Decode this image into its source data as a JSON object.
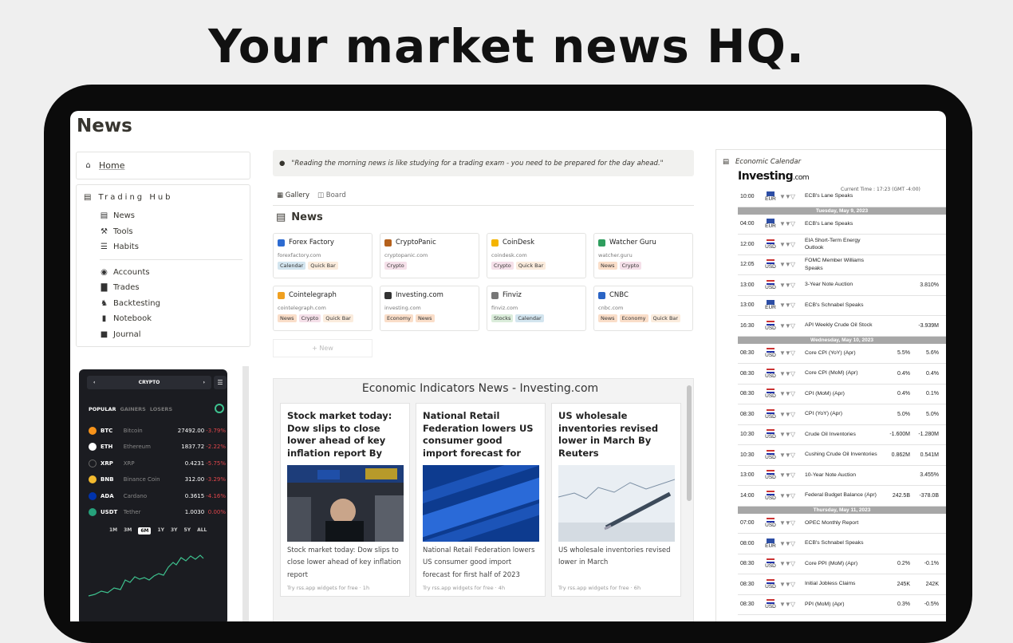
{
  "hero": {
    "title": "Your market news HQ."
  },
  "page": {
    "title": "News"
  },
  "sidebar": {
    "home": "Home",
    "hub_title": "Trading Hub",
    "group1": [
      {
        "label": "News",
        "icon": "newspaper-icon"
      },
      {
        "label": "Tools",
        "icon": "wrench-icon"
      },
      {
        "label": "Habits",
        "icon": "checklist-icon"
      }
    ],
    "group2": [
      {
        "label": "Accounts",
        "icon": "user-circle-icon"
      },
      {
        "label": "Trades",
        "icon": "bar-chart-icon"
      },
      {
        "label": "Backtesting",
        "icon": "chess-icon"
      },
      {
        "label": "Notebook",
        "icon": "book-icon"
      },
      {
        "label": "Journal",
        "icon": "journal-icon"
      }
    ]
  },
  "crypto_widget": {
    "header": "CRYPTO",
    "tabs": [
      "POPULAR",
      "GAINERS",
      "LOSERS"
    ],
    "rows": [
      {
        "symbol": "BTC",
        "name": "Bitcoin",
        "price": "27492.00",
        "change": "-3.79%",
        "color": "#f7931a"
      },
      {
        "symbol": "ETH",
        "name": "Ethereum",
        "price": "1837.72",
        "change": "-2.22%",
        "color": "#ffffff"
      },
      {
        "symbol": "XRP",
        "name": "XRP",
        "price": "0.4231",
        "change": "-5.75%",
        "color": "#1b1c21"
      },
      {
        "symbol": "BNB",
        "name": "Binance Coin",
        "price": "312.00",
        "change": "-3.29%",
        "color": "#f3ba2f"
      },
      {
        "symbol": "ADA",
        "name": "Cardano",
        "price": "0.3615",
        "change": "-4.16%",
        "color": "#0033ad"
      },
      {
        "symbol": "USDT",
        "name": "Tether",
        "price": "1.0030",
        "change": "0.00%",
        "color": "#26a17b"
      }
    ],
    "ranges": [
      "1M",
      "3M",
      "6M",
      "1Y",
      "3Y",
      "5Y",
      "ALL"
    ],
    "active_range": "6M"
  },
  "quote": "\"Reading the morning news is like studying for a trading exam - you need to be prepared for the day ahead.\"",
  "views": {
    "gallery": "Gallery",
    "board": "Board"
  },
  "news_heading": "News",
  "sources": [
    {
      "name": "Forex Factory",
      "url": "forexfactory.com",
      "tags": [
        "Calendar",
        "Quick Bar"
      ],
      "color": "#2d6bd1"
    },
    {
      "name": "CryptoPanic",
      "url": "cryptopanic.com",
      "tags": [
        "Crypto"
      ],
      "color": "#b5611c"
    },
    {
      "name": "CoinDesk",
      "url": "coindesk.com",
      "tags": [
        "Crypto",
        "Quick Bar"
      ],
      "color": "#f4b400"
    },
    {
      "name": "Watcher Guru",
      "url": "watcher.guru",
      "tags": [
        "News",
        "Crypto"
      ],
      "color": "#2f9e5e"
    },
    {
      "name": "Cointelegraph",
      "url": "cointelegraph.com",
      "tags": [
        "News",
        "Crypto",
        "Quick Bar"
      ],
      "color": "#f0a020"
    },
    {
      "name": "Investing.com",
      "url": "investing.com",
      "tags": [
        "Economy",
        "News"
      ],
      "color": "#333333"
    },
    {
      "name": "Finviz",
      "url": "finviz.com",
      "tags": [
        "Stocks",
        "Calendar"
      ],
      "color": "#777777"
    },
    {
      "name": "CNBC",
      "url": "cnbc.com",
      "tags": [
        "News",
        "Economy",
        "Quick Bar"
      ],
      "color": "#2a64c5"
    }
  ],
  "tag_colors": {
    "Calendar": "#d3e5ef",
    "Quick Bar": "#fbecdd",
    "Crypto": "#f5e0e9",
    "News": "#fadec9",
    "Economy": "#fadec9",
    "Stocks": "#dbeddb"
  },
  "new_label": "+ New",
  "rss": {
    "title": "Economic Indicators News - Investing.com",
    "items": [
      {
        "headline": "Stock market today: Dow slips to close lower ahead of key inflation report By Investing.com",
        "desc": "Stock market today: Dow slips to close lower ahead of key inflation report",
        "footer": "Try rss.app widgets for free  ·  1h"
      },
      {
        "headline": "National Retail Federation lowers US consumer good import forecast for first half of...",
        "desc": "National Retail Federation lowers US consumer good import forecast for first half of 2023",
        "footer": "Try rss.app widgets for free  ·  4h"
      },
      {
        "headline": "US wholesale inventories revised lower in March By Reuters",
        "desc": "US wholesale inventories revised lower in March",
        "footer": "Try rss.app widgets for free  ·  6h"
      }
    ]
  },
  "calendar": {
    "title": "Economic Calendar",
    "logo": "Investing",
    "logo_suffix": ".com",
    "current_time": "Current Time : 17:23 (GMT -4:00)",
    "first_row": {
      "time": "10:00",
      "cur": "EUR",
      "event": "ECB's Lane Speaks",
      "actual": "",
      "forecast": ""
    },
    "sections": [
      {
        "day": "Tuesday, May 9, 2023",
        "rows": [
          {
            "time": "04:00",
            "cur": "EUR",
            "event": "ECB's Lane Speaks",
            "actual": "",
            "forecast": ""
          },
          {
            "time": "12:00",
            "cur": "USD",
            "event": "EIA Short-Term Energy Outlook",
            "actual": "",
            "forecast": ""
          },
          {
            "time": "12:05",
            "cur": "USD",
            "event": "FOMC Member Williams Speaks",
            "actual": "",
            "forecast": ""
          },
          {
            "time": "13:00",
            "cur": "USD",
            "event": "3-Year Note Auction",
            "actual": "",
            "forecast": "3.810%"
          },
          {
            "time": "13:00",
            "cur": "EUR",
            "event": "ECB's Schnabel Speaks",
            "actual": "",
            "forecast": ""
          },
          {
            "time": "16:30",
            "cur": "USD",
            "event": "API Weekly Crude Oil Stock",
            "actual": "",
            "forecast": "-3.939M"
          }
        ]
      },
      {
        "day": "Wednesday, May 10, 2023",
        "rows": [
          {
            "time": "08:30",
            "cur": "USD",
            "event": "Core CPI (YoY) (Apr)",
            "actual": "5.5%",
            "forecast": "5.6%"
          },
          {
            "time": "08:30",
            "cur": "USD",
            "event": "Core CPI (MoM) (Apr)",
            "actual": "0.4%",
            "forecast": "0.4%"
          },
          {
            "time": "08:30",
            "cur": "USD",
            "event": "CPI (MoM) (Apr)",
            "actual": "0.4%",
            "forecast": "0.1%"
          },
          {
            "time": "08:30",
            "cur": "USD",
            "event": "CPI (YoY) (Apr)",
            "actual": "5.0%",
            "forecast": "5.0%"
          },
          {
            "time": "10:30",
            "cur": "USD",
            "event": "Crude Oil Inventories",
            "actual": "-1.600M",
            "forecast": "-1.280M"
          },
          {
            "time": "10:30",
            "cur": "USD",
            "event": "Cushing Crude Oil Inventories",
            "actual": "0.862M",
            "forecast": "0.541M"
          },
          {
            "time": "13:00",
            "cur": "USD",
            "event": "10-Year Note Auction",
            "actual": "",
            "forecast": "3.455%"
          },
          {
            "time": "14:00",
            "cur": "USD",
            "event": "Federal Budget Balance (Apr)",
            "actual": "242.5B",
            "forecast": "-378.0B"
          }
        ]
      },
      {
        "day": "Thursday, May 11, 2023",
        "rows": [
          {
            "time": "07:00",
            "cur": "USD",
            "event": "OPEC Monthly Report",
            "actual": "",
            "forecast": ""
          },
          {
            "time": "08:00",
            "cur": "EUR",
            "event": "ECB's Schnabel Speaks",
            "actual": "",
            "forecast": ""
          },
          {
            "time": "08:30",
            "cur": "USD",
            "event": "Core PPI (MoM) (Apr)",
            "actual": "0.2%",
            "forecast": "-0.1%"
          },
          {
            "time": "08:30",
            "cur": "USD",
            "event": "Initial Jobless Claims",
            "actual": "245K",
            "forecast": "242K"
          },
          {
            "time": "08:30",
            "cur": "USD",
            "event": "PPI (MoM) (Apr)",
            "actual": "0.3%",
            "forecast": "-0.5%"
          }
        ]
      }
    ]
  }
}
